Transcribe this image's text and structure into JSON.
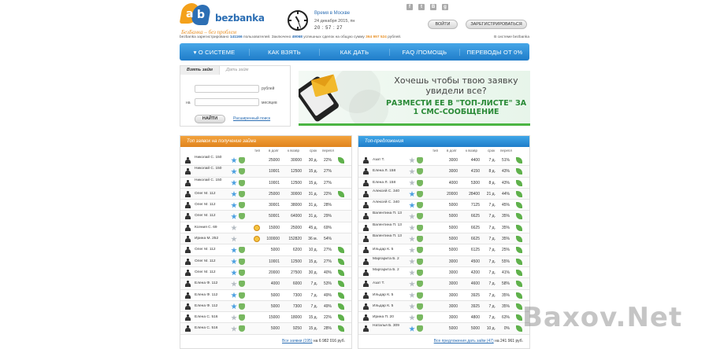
{
  "header": {
    "brand": "bezbanka",
    "slogan": "БезБанка – без проблем",
    "time_label": "Время в Москве",
    "date": "24 декабря 2015, пн",
    "time": "20 : 57 : 27",
    "login_label": "ВОЙТИ",
    "register_label": "ЗАРЕГИСТРИРОВАТЬСЯ",
    "social": [
      "f",
      "t",
      "B",
      "g"
    ]
  },
  "stats": {
    "t1": "bezbanka зарегистрировано",
    "users": "141166",
    "t2": "пользователей. Заключено",
    "deals": "49068",
    "t3": "успешных сделок на общую сумму",
    "sum": "364 997 524",
    "t4": "рублей.",
    "right": "В системе bezbanka"
  },
  "nav": [
    "▾   О СИСТЕМЕ",
    "КАК ВЗЯТЬ",
    "КАК ДАТЬ",
    "FAQ /ПОМОЩЬ",
    "ПЕРЕВОДЫ ОТ 0%"
  ],
  "search": {
    "tab_take": "Взять займ",
    "tab_give": "Дать займ",
    "unit_amount": "рублей",
    "na": "на",
    "unit_term": "месяцев",
    "find_label": "НАЙТИ",
    "advanced": "Расширенный поиск"
  },
  "banner": {
    "question": "Хочешь чтобы твою заявку увидели все?",
    "action": "Размести ее в \"топ-листе\" за 1 СМС-сообщение"
  },
  "left_table": {
    "title": "Топ заявок на получение займа",
    "cols": [
      "тип",
      "в долг",
      "к возвр",
      "срок",
      "перепл"
    ],
    "rows": [
      {
        "name": "Николай С. 150",
        "star": "blue",
        "badge": "shield",
        "a": "25000",
        "b": "30000",
        "term": "30 д.",
        "p": "22%",
        "leaf": true
      },
      {
        "name": "Николай С. 150",
        "star": "blue",
        "badge": "shield",
        "a": "10001",
        "b": "12500",
        "term": "15 д.",
        "p": "27%",
        "leaf": false
      },
      {
        "name": "Николай С. 150",
        "star": "blue",
        "badge": "shield",
        "a": "10001",
        "b": "12500",
        "term": "15 д.",
        "p": "27%",
        "leaf": false
      },
      {
        "name": "Олег М. 112",
        "star": "blue",
        "badge": "shield",
        "a": "25000",
        "b": "30000",
        "term": "31 д.",
        "p": "22%",
        "leaf": true
      },
      {
        "name": "Олег М. 112",
        "star": "blue",
        "badge": "shield",
        "a": "30001",
        "b": "38000",
        "term": "31 д.",
        "p": "28%",
        "leaf": false
      },
      {
        "name": "Олег М. 112",
        "star": "blue",
        "badge": "shield",
        "a": "50001",
        "b": "64000",
        "term": "31 д.",
        "p": "29%",
        "leaf": false
      },
      {
        "name": "Ксения С. 69",
        "star": "grey",
        "badge": "smile",
        "a": "15000",
        "b": "25000",
        "term": "45 д.",
        "p": "69%",
        "leaf": false
      },
      {
        "name": "Ирина М. 252",
        "star": "grey",
        "badge": "smile",
        "a": "100000",
        "b": "152820",
        "term": "36 м.",
        "p": "54%",
        "leaf": false
      },
      {
        "name": "Олег М. 112",
        "star": "blue",
        "badge": "shield",
        "a": "5000",
        "b": "6200",
        "term": "10 д.",
        "p": "27%",
        "leaf": true
      },
      {
        "name": "Олег М. 112",
        "star": "blue",
        "badge": "shield",
        "a": "10001",
        "b": "12500",
        "term": "15 д.",
        "p": "27%",
        "leaf": true
      },
      {
        "name": "Олег М. 112",
        "star": "blue",
        "badge": "shield",
        "a": "20000",
        "b": "27500",
        "term": "30 д.",
        "p": "40%",
        "leaf": true
      },
      {
        "name": "Елена Ф. 112",
        "star": "grey",
        "badge": "shield",
        "a": "4000",
        "b": "6000",
        "term": "7 д.",
        "p": "53%",
        "leaf": true
      },
      {
        "name": "Елена Ф. 112",
        "star": "blue",
        "badge": "shield",
        "a": "5000",
        "b": "7300",
        "term": "7 д.",
        "p": "49%",
        "leaf": true
      },
      {
        "name": "Елена Ф. 112",
        "star": "blue",
        "badge": "shield",
        "a": "5000",
        "b": "7300",
        "term": "7 д.",
        "p": "49%",
        "leaf": true
      },
      {
        "name": "Елена С. 516",
        "star": "grey",
        "badge": "shield",
        "a": "15000",
        "b": "18000",
        "term": "15 д.",
        "p": "22%",
        "leaf": true
      },
      {
        "name": "Елена С. 516",
        "star": "grey",
        "badge": "shield",
        "a": "5000",
        "b": "9250",
        "term": "15 д.",
        "p": "28%",
        "leaf": true
      }
    ],
    "footer_link": "Все заявки (195)",
    "footer_text": "на 6 982 016 руб."
  },
  "right_table": {
    "title": "Топ-предложения",
    "cols": [
      "тип",
      "в долг",
      "к возвр",
      "срок",
      "перепл"
    ],
    "rows": [
      {
        "name": "Азат Т.",
        "star": "grey",
        "badge": "shield",
        "a": "3000",
        "b": "4400",
        "term": "7 д.",
        "p": "51%",
        "leaf": true
      },
      {
        "name": "Елена Л. 158",
        "star": "grey",
        "badge": "shield",
        "a": "3000",
        "b": "4150",
        "term": "8 д.",
        "p": "43%",
        "leaf": true
      },
      {
        "name": "Елена Л. 158",
        "star": "grey",
        "badge": "shield",
        "a": "4000",
        "b": "5300",
        "term": "8 д.",
        "p": "43%",
        "leaf": true
      },
      {
        "name": "Алексей С. 340",
        "star": "blue",
        "badge": "shield",
        "a": "20000",
        "b": "28400",
        "term": "21 д.",
        "p": "44%",
        "leaf": true
      },
      {
        "name": "Алексей С. 340",
        "star": "blue",
        "badge": "shield",
        "a": "5000",
        "b": "7125",
        "term": "7 д.",
        "p": "45%",
        "leaf": true
      },
      {
        "name": "Валентина П. 13",
        "star": "grey",
        "badge": "shield",
        "a": "5000",
        "b": "6625",
        "term": "7 д.",
        "p": "35%",
        "leaf": true
      },
      {
        "name": "Валентина П. 13",
        "star": "grey",
        "badge": "shield",
        "a": "5000",
        "b": "6625",
        "term": "7 д.",
        "p": "35%",
        "leaf": true
      },
      {
        "name": "Валентина П. 13",
        "star": "grey",
        "badge": "shield",
        "a": "5000",
        "b": "6625",
        "term": "7 д.",
        "p": "35%",
        "leaf": true
      },
      {
        "name": "Ильдар К. 5",
        "star": "grey",
        "badge": "shield",
        "a": "5000",
        "b": "6125",
        "term": "7 д.",
        "p": "25%",
        "leaf": true
      },
      {
        "name": "Маргарита Б. 2",
        "star": "grey",
        "badge": "shield",
        "a": "3000",
        "b": "4500",
        "term": "7 д.",
        "p": "55%",
        "leaf": true
      },
      {
        "name": "Маргарита Б. 2",
        "star": "grey",
        "badge": "shield",
        "a": "3000",
        "b": "4200",
        "term": "7 д.",
        "p": "41%",
        "leaf": true
      },
      {
        "name": "Азат Т.",
        "star": "grey",
        "badge": "shield",
        "a": "3000",
        "b": "4600",
        "term": "7 д.",
        "p": "58%",
        "leaf": true
      },
      {
        "name": "Ильдар К. 5",
        "star": "grey",
        "badge": "shield",
        "a": "3000",
        "b": "3925",
        "term": "7 д.",
        "p": "35%",
        "leaf": true
      },
      {
        "name": "Ильдар К. 5",
        "star": "grey",
        "badge": "shield",
        "a": "3000",
        "b": "3925",
        "term": "7 д.",
        "p": "35%",
        "leaf": true
      },
      {
        "name": "Ирина П. 20",
        "star": "grey",
        "badge": "shield",
        "a": "3000",
        "b": "4800",
        "term": "7 д.",
        "p": "63%",
        "leaf": true
      },
      {
        "name": "Наталья Б. 309",
        "star": "blue",
        "badge": "shield",
        "a": "5000",
        "b": "5000",
        "term": "10 д.",
        "p": "0%",
        "leaf": true
      }
    ],
    "footer_link": "Все предложения дать займ (47)",
    "footer_text": "на 241 961 руб."
  },
  "watermark": "Baxov.Net"
}
